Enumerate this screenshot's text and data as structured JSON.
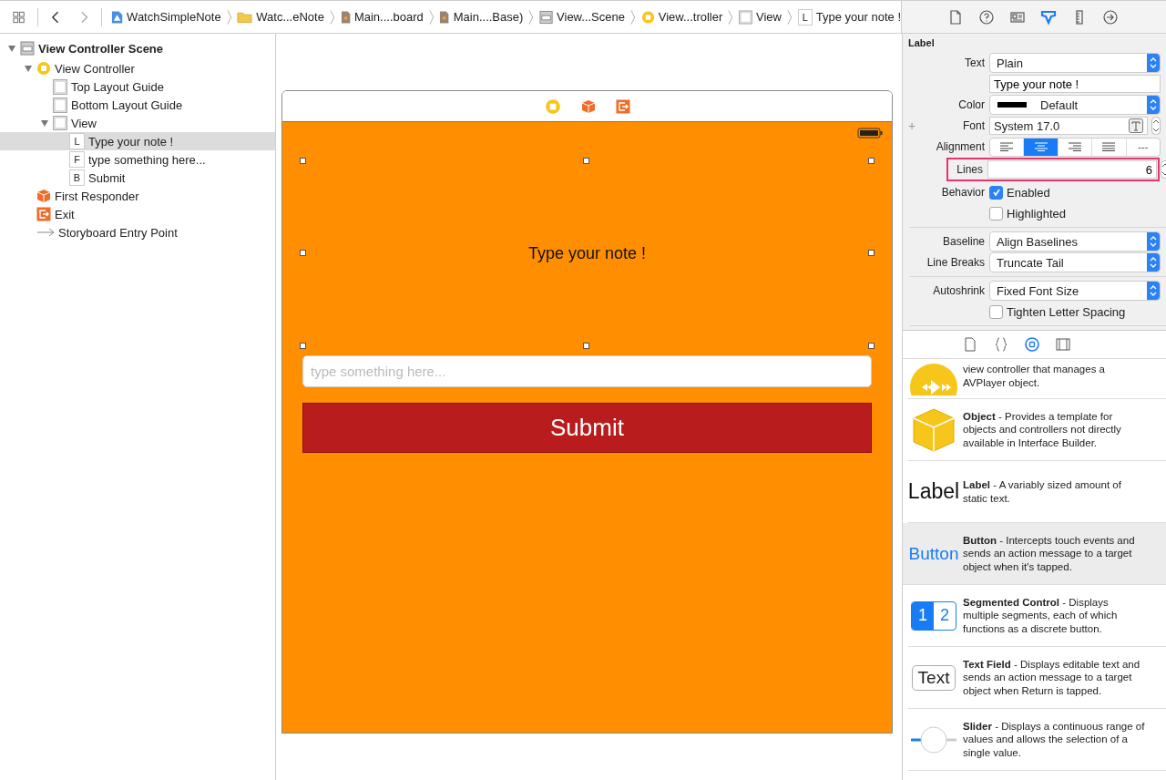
{
  "toolbar": {
    "breadcrumbs": [
      {
        "kind": "app",
        "label": "WatchSimpleNote"
      },
      {
        "kind": "folder",
        "label": "Watc...eNote"
      },
      {
        "kind": "storyboard",
        "label": "Main....board"
      },
      {
        "kind": "storyboard",
        "label": "Main....Base)"
      },
      {
        "kind": "scene",
        "label": "View...Scene"
      },
      {
        "kind": "controller",
        "label": "View...troller"
      },
      {
        "kind": "view",
        "label": "View"
      },
      {
        "kind": "letter",
        "badge": "L",
        "label": "Type your note !"
      }
    ]
  },
  "navigator": {
    "tree": [
      {
        "kind": "scene",
        "label": "View Controller Scene",
        "expanded": true,
        "selected": false,
        "children": [
          {
            "kind": "controller",
            "label": "View Controller",
            "expanded": true,
            "selected": false,
            "children": [
              {
                "kind": "guide",
                "label": "Top Layout Guide",
                "selected": false
              },
              {
                "kind": "guide",
                "label": "Bottom Layout Guide",
                "selected": false
              },
              {
                "kind": "view",
                "label": "View",
                "expanded": true,
                "selected": false,
                "children": [
                  {
                    "kind": "letter",
                    "badge": "L",
                    "label": "Type your note !",
                    "selected": true
                  },
                  {
                    "kind": "letter",
                    "badge": "F",
                    "label": "type something here...",
                    "selected": false
                  },
                  {
                    "kind": "letter",
                    "badge": "B",
                    "label": "Submit",
                    "selected": false
                  }
                ]
              }
            ]
          },
          {
            "kind": "responder",
            "label": "First Responder",
            "selected": false
          },
          {
            "kind": "exit",
            "label": "Exit",
            "selected": false
          },
          {
            "kind": "entry",
            "label": "Storyboard Entry Point",
            "selected": false
          }
        ]
      }
    ]
  },
  "canvas": {
    "dock": [
      {
        "kind": "controller"
      },
      {
        "kind": "responder"
      },
      {
        "kind": "exit"
      }
    ],
    "label": "Type your note !",
    "field": {
      "placeholder": "type something here..."
    },
    "button": "Submit"
  },
  "inspector": {
    "tabs": [
      {
        "kind": "file",
        "selected": false
      },
      {
        "kind": "help",
        "selected": false
      },
      {
        "kind": "identity",
        "selected": false
      },
      {
        "kind": "attributes",
        "selected": true
      },
      {
        "kind": "size",
        "selected": false
      },
      {
        "kind": "connections",
        "selected": false
      }
    ],
    "title": "Label",
    "rows": [
      {
        "kind": "popup",
        "label": "Text",
        "value": "Plain"
      },
      {
        "kind": "text",
        "value": "Type your note !"
      },
      {
        "kind": "color",
        "label": "Color",
        "value": "Default"
      },
      {
        "kind": "font",
        "plus": "+",
        "label": "Font",
        "value": "System 17.0"
      },
      {
        "kind": "segmented",
        "label": "Alignment",
        "segments": [
          {
            "kind": "left",
            "selected": false
          },
          {
            "kind": "center",
            "selected": true
          },
          {
            "kind": "right",
            "selected": false
          },
          {
            "kind": "justified",
            "selected": false
          },
          {
            "kind": "natural",
            "text": "---",
            "selected": false
          }
        ]
      },
      {
        "kind": "stepper",
        "label": "Lines",
        "value": "6",
        "highlighted": true
      },
      {
        "kind": "checkbox",
        "label": "Behavior",
        "text": "Enabled",
        "checked": true
      },
      {
        "kind": "checkbox",
        "text": "Highlighted",
        "checked": false
      },
      {
        "kind": "divider"
      },
      {
        "kind": "popup",
        "label": "Baseline",
        "value": "Align Baselines"
      },
      {
        "kind": "popup",
        "label": "Line Breaks",
        "value": "Truncate Tail"
      },
      {
        "kind": "divider"
      },
      {
        "kind": "popup",
        "label": "Autoshrink",
        "value": "Fixed Font Size"
      },
      {
        "kind": "checkbox",
        "text": "Tighten Letter Spacing",
        "checked": false
      },
      {
        "kind": "divider"
      }
    ]
  },
  "library": {
    "tabs": [
      {
        "kind": "file",
        "selected": false
      },
      {
        "kind": "code",
        "selected": false
      },
      {
        "kind": "object",
        "selected": true
      },
      {
        "kind": "media",
        "selected": false
      }
    ],
    "items": [
      {
        "kind": "avplayer",
        "text": "view controller that manages a AVPlayer object.",
        "selected": false
      },
      {
        "kind": "object",
        "text": "**Object** - Provides a template for objects and controllers not directly available in Interface Builder.",
        "selected": false
      },
      {
        "kind": "label",
        "glyph": "Label",
        "text": "**Label** - A variably sized amount of static text.",
        "selected": false
      },
      {
        "kind": "button",
        "glyph": "Button",
        "text": "**Button** - Intercepts touch events and sends an action message to a target object when it's tapped.",
        "selected": true
      },
      {
        "kind": "segmented",
        "segments": [
          "1",
          "2"
        ],
        "text": "**Segmented Control** - Displays multiple segments, each of which functions as a discrete button.",
        "selected": false
      },
      {
        "kind": "textfield",
        "glyph": "Text",
        "text": "**Text Field** - Displays editable text and sends an action message to a target object when Return is tapped.",
        "selected": false
      },
      {
        "kind": "slider",
        "text": "**Slider** - Displays a continuous range of values and allows the selection of a single value.",
        "selected": false
      }
    ]
  }
}
